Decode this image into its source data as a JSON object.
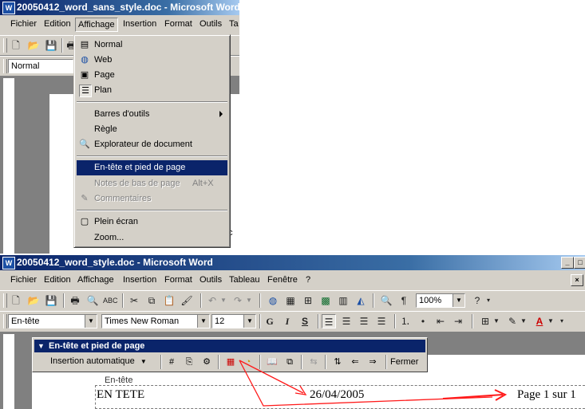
{
  "window1": {
    "title": "20050412_word_sans_style.doc - Microsoft Word",
    "menus": [
      "Fichier",
      "Edition",
      "Affichage",
      "Insertion",
      "Format",
      "Outils",
      "Ta"
    ],
    "style_box": "Normal"
  },
  "view_menu": {
    "items": [
      {
        "label": "Normal",
        "icon": "normal-view-icon"
      },
      {
        "label": "Web",
        "icon": "web-view-icon"
      },
      {
        "label": "Page",
        "icon": "page-view-icon"
      },
      {
        "label": "Plan",
        "icon": "outline-view-icon"
      },
      {
        "label": "Barres d'outils"
      },
      {
        "label": "Règle"
      },
      {
        "label": "Explorateur de document",
        "icon": "document-map-icon"
      },
      {
        "label": "En-tête et pied de page"
      },
      {
        "label": "Notes de bas de page",
        "shortcut": "Alt+X"
      },
      {
        "label": "Commentaires",
        "icon": "comments-icon"
      },
      {
        "label": "Plein écran",
        "icon": "full-screen-icon"
      },
      {
        "label": "Zoom..."
      }
    ]
  },
  "window2": {
    "title": "20050412_word_style.doc - Microsoft Word",
    "menus": [
      "Fichier",
      "Edition",
      "Affichage",
      "Insertion",
      "Format",
      "Outils",
      "Tableau",
      "Fenêtre",
      "?"
    ],
    "zoom": "100%",
    "style": "En-tête",
    "font": "Times New Roman",
    "size": "12",
    "format_buttons": [
      "G",
      "I",
      "S"
    ]
  },
  "hf_toolbar": {
    "title": "En-tête et pied de page",
    "autotext": "Insertion automatique",
    "close": "Fermer"
  },
  "document": {
    "header_label": "En-tête",
    "left_text": "EN TETE",
    "date": "26/04/2005",
    "page": "Page 1 sur 1"
  },
  "colors": {
    "title_bar": "#0a246a",
    "highlight": "#0a246a",
    "annotation": "#ff0000"
  }
}
